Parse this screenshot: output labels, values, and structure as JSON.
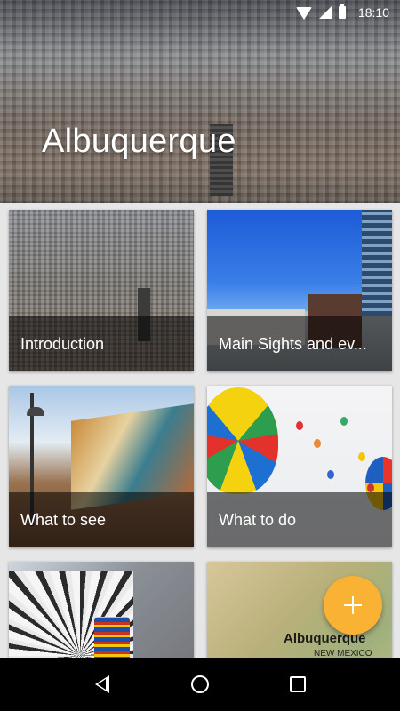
{
  "status_bar": {
    "time": "18:10",
    "icons": [
      "wifi-icon",
      "signal-icon",
      "battery-icon"
    ]
  },
  "hero": {
    "title": "Albuquerque"
  },
  "cards": [
    {
      "label": "Introduction"
    },
    {
      "label": "Main Sights and ev..."
    },
    {
      "label": "What to see"
    },
    {
      "label": "What to do"
    },
    {
      "label": ""
    },
    {
      "label": ""
    }
  ],
  "map_card": {
    "city_label": "Albuquerque",
    "region_label": "NEW MEXICO"
  },
  "fab": {
    "icon": "plus-icon",
    "color": "#f9b233"
  },
  "nav_bar": {
    "icons": [
      "back-icon",
      "home-icon",
      "recent-apps-icon"
    ]
  }
}
